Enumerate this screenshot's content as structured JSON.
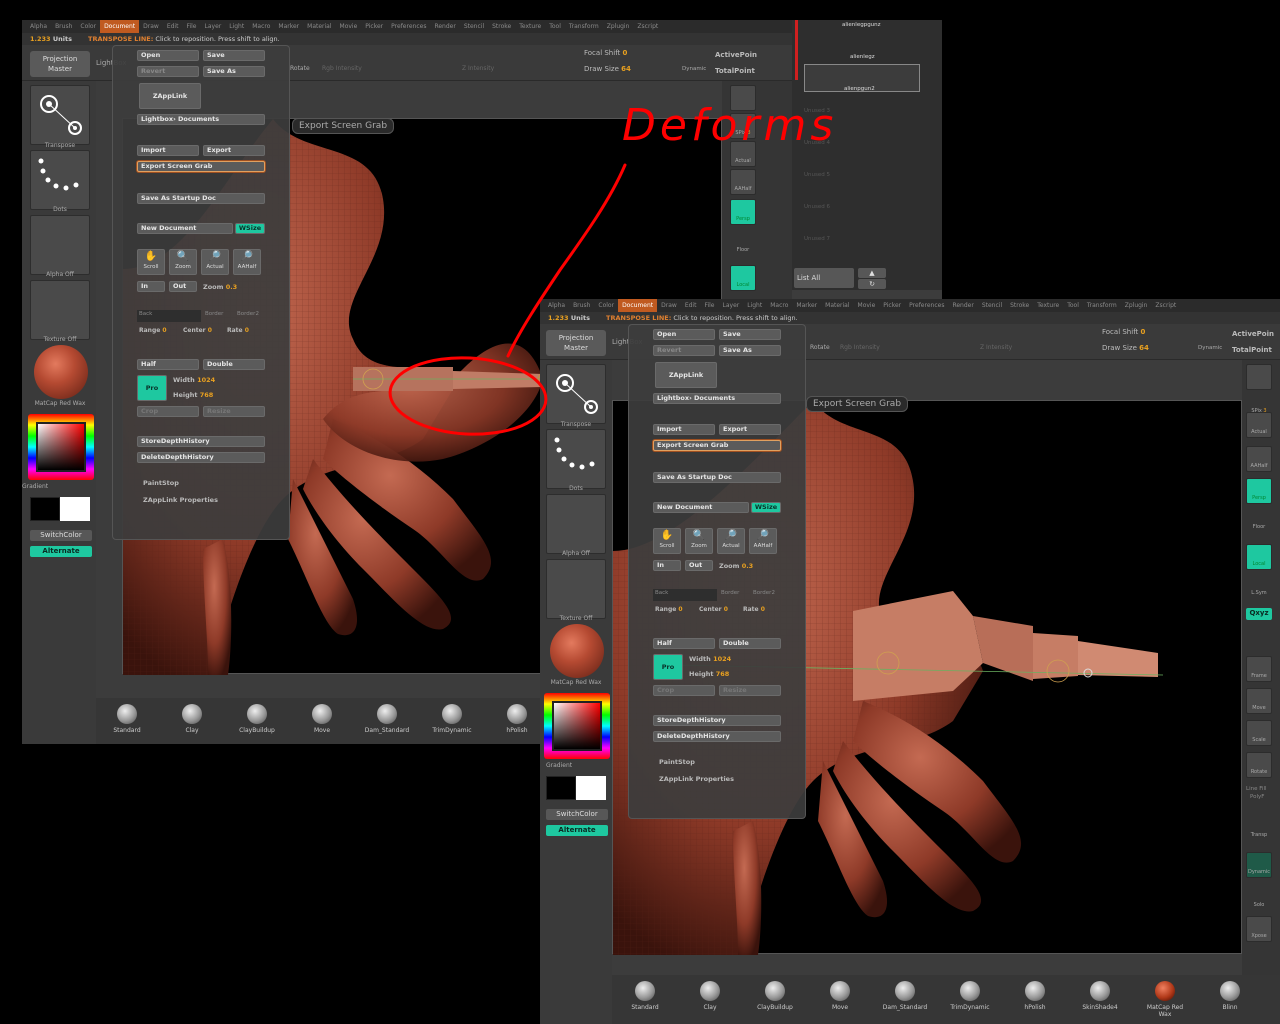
{
  "menu_items": [
    "Alpha",
    "Brush",
    "Color",
    "Document",
    "Draw",
    "Edit",
    "File",
    "Layer",
    "Light",
    "Macro",
    "Marker",
    "Material",
    "Movie",
    "Picker",
    "Preferences",
    "Render",
    "Stencil",
    "Stroke",
    "Texture",
    "Tool",
    "Transform",
    "Zplugin",
    "Zscript"
  ],
  "active_menu": "Document",
  "info": {
    "units_value": "1.233",
    "units_label": "Units",
    "transpose_label": "TRANSPOSE LINE:",
    "transpose_msg": "Click to reposition. Press shift to align."
  },
  "projection_master": "Projection Master",
  "lightbox": "LightBox",
  "focal_shift": {
    "label": "Focal Shift",
    "value": "0"
  },
  "draw_size": {
    "label": "Draw Size",
    "value": "64"
  },
  "dynamic": "Dynamic",
  "active_points": "ActivePoin",
  "total_points": "TotalPoint",
  "rgb_intensity": "Rgb Intensity",
  "z_intensity": "Z Intensity",
  "rotate": "Rotate",
  "tools": {
    "transpose": "Transpose",
    "dots": "Dots",
    "alpha": "Alpha Off",
    "texture": "Texture Off",
    "material": "MatCap Red Wax",
    "gradient": "Gradient",
    "switch_color": "SwitchColor",
    "alternate": "Alternate"
  },
  "doc_menu": {
    "open": "Open",
    "save": "Save",
    "revert": "Revert",
    "save_as": "Save As",
    "zapplink": "ZAppLink",
    "lightbox_documents": "Lightbox› Documents",
    "import": "Import",
    "export": "Export",
    "export_screen_grab": "Export Screen Grab",
    "save_startup": "Save As Startup Doc",
    "new_document": "New Document",
    "wsize": "WSize",
    "scroll": "Scroll",
    "zoom": "Zoom",
    "actual": "Actual",
    "aahalf": "AAHalf",
    "in": "In",
    "out": "Out",
    "zoom_val_label": "Zoom",
    "zoom_val": "0.3",
    "back": "Back",
    "border": "Border",
    "border2": "Border2",
    "range": "Range",
    "range_val": "0",
    "center": "Center",
    "center_val": "0",
    "rate": "Rate",
    "rate_val": "0",
    "half": "Half",
    "double": "Double",
    "pro": "Pro",
    "width_label": "Width",
    "width_val": "1024",
    "height_label": "Height",
    "height_val": "768",
    "crop": "Crop",
    "resize": "Resize",
    "store_depth": "StoreDepthHistory",
    "delete_depth": "DeleteDepthHistory",
    "paintstop": "PaintStop",
    "zapplink_props": "ZAppLink Properties"
  },
  "tooltip": "Export Screen Grab",
  "right_shelf": {
    "spix_label": "SPix",
    "spix_val": "3",
    "actual": "Actual",
    "aahalf": "AAHalf",
    "persp": "Persp",
    "floor": "Floor",
    "local": "Local",
    "lsym": "L.Sym",
    "xyz": "Qxyz",
    "frame": "Frame",
    "move": "Move",
    "scale": "Scale",
    "rotate": "Rotate",
    "linefill": "Line Fill",
    "polyf": "PolyF",
    "transp": "Transp",
    "dynamic": "Dynamic",
    "solo": "Solo",
    "xpose": "Xpose"
  },
  "subtools": {
    "item1": "alienlegpgunz",
    "item2": "alienlegz",
    "item3": "alienpgun2",
    "unused": [
      "Unused 3",
      "Unused 4",
      "Unused 5",
      "Unused 6",
      "Unused 7"
    ],
    "list_all": "List All"
  },
  "brushes": [
    "Standard",
    "Clay",
    "ClayBuildup",
    "Move",
    "Dam_Standard",
    "TrimDynamic",
    "hPolish",
    "SkinShade4",
    "MatCap Red Wax",
    "Blinn"
  ],
  "annotation": {
    "text": "Deforms",
    "color": "#ff0000"
  }
}
